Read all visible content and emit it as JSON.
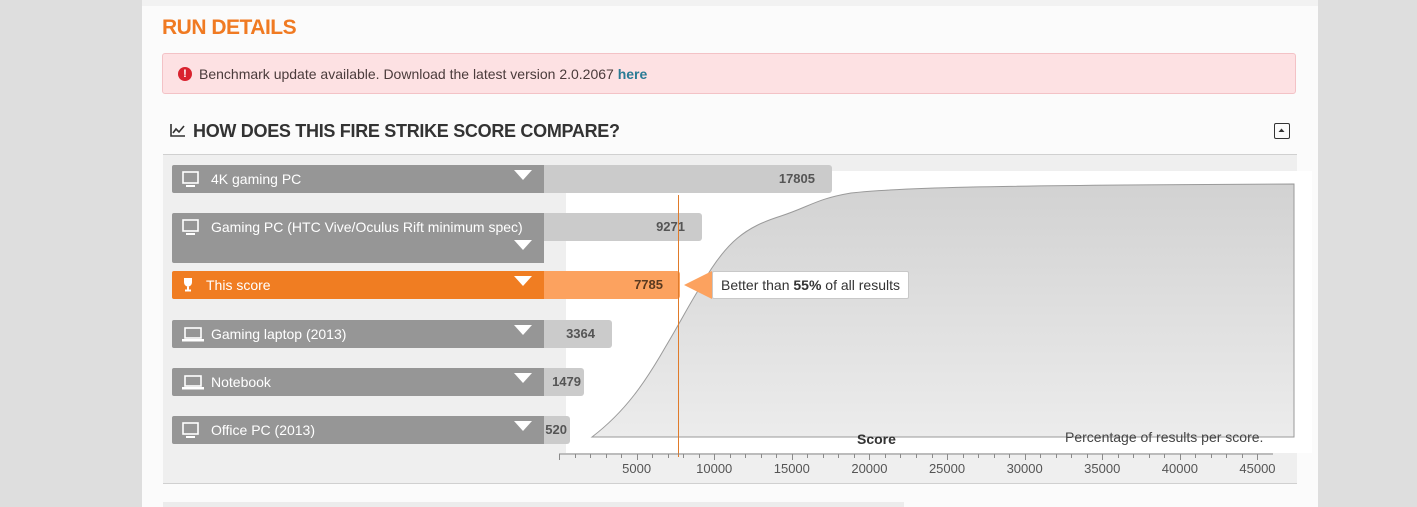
{
  "page": {
    "title": "RUN DETAILS"
  },
  "alert": {
    "text": "Benchmark update available. Download the latest version 2.0.2067",
    "link": "here"
  },
  "section": {
    "title": "HOW DOES THIS FIRE STRIKE SCORE COMPARE?"
  },
  "rows": [
    {
      "label": "4K gaming PC",
      "score": "17805",
      "icon": "desktop-icon",
      "value": 17805
    },
    {
      "label": "Gaming PC (HTC Vive/Oculus Rift minimum spec)",
      "score": "9271",
      "icon": "desktop-icon",
      "value": 9271
    },
    {
      "label": "This score",
      "score": "7785",
      "icon": "trophy-icon",
      "value": 7785,
      "highlight": true
    },
    {
      "label": "Gaming laptop (2013)",
      "score": "3364",
      "icon": "laptop-icon",
      "value": 3364
    },
    {
      "label": "Notebook",
      "score": "1479",
      "icon": "laptop-icon",
      "value": 1479
    },
    {
      "label": "Office PC (2013)",
      "score": "520",
      "icon": "desktop-icon",
      "value": 520
    }
  ],
  "callout": {
    "prefix": "Better than ",
    "value": "55%",
    "suffix": " of all results"
  },
  "chart": {
    "xlabel": "Score",
    "note": "Percentage of results per score.",
    "ticks": [
      "5000",
      "10000",
      "15000",
      "20000",
      "25000",
      "30000",
      "35000",
      "40000",
      "45000"
    ],
    "xlim": [
      0,
      46000
    ]
  },
  "colors": {
    "accent": "#f07a22",
    "highlight_bar": "#fca25f",
    "alert_bg": "#fde1e3",
    "alert_icon": "#d9232f",
    "link": "#2a7b95"
  }
}
